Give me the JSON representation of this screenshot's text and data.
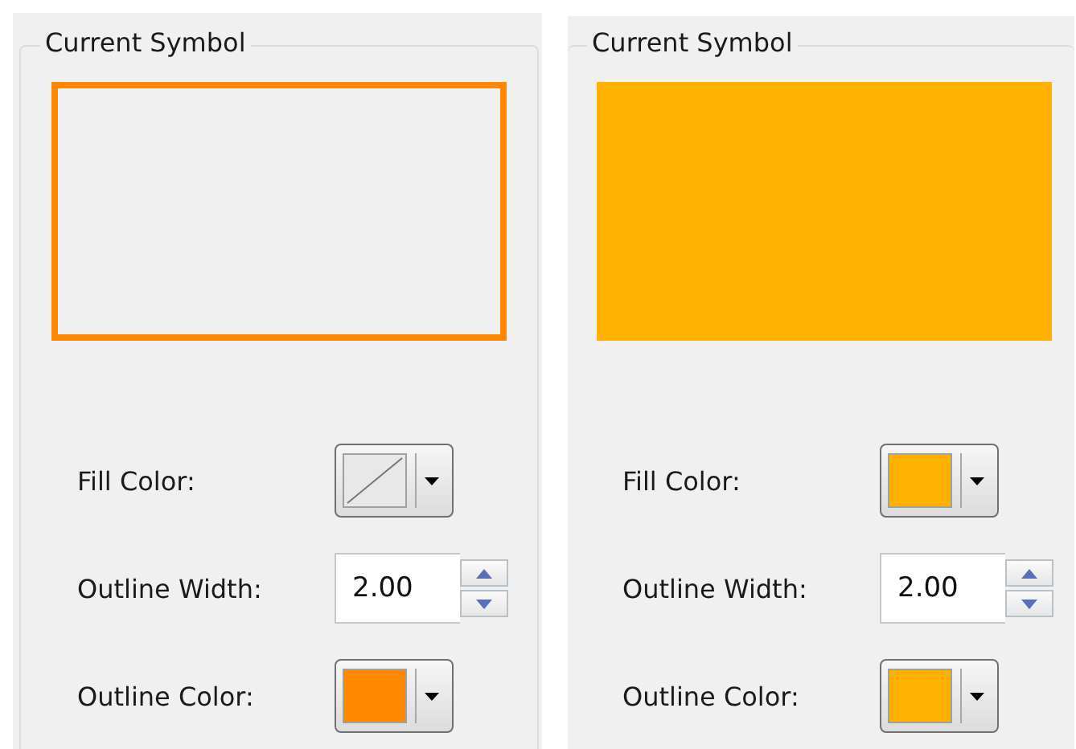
{
  "panels": [
    {
      "title": "Current Symbol",
      "fill_color": {
        "kind": "none"
      },
      "fields": {
        "fill_label": "Fill Color:",
        "width_label": "Outline Width:",
        "width_value": "2.00",
        "outline_label": "Outline Color:"
      },
      "outline": {
        "color": "#ff8800"
      }
    },
    {
      "title": "Current Symbol",
      "fill_color": {
        "kind": "solid",
        "color": "#ffb000"
      },
      "fields": {
        "fill_label": "Fill Color:",
        "width_label": "Outline Width:",
        "width_value": "2.00",
        "outline_label": "Outline Color:"
      },
      "outline": {
        "color": "#ffb000"
      }
    }
  ]
}
